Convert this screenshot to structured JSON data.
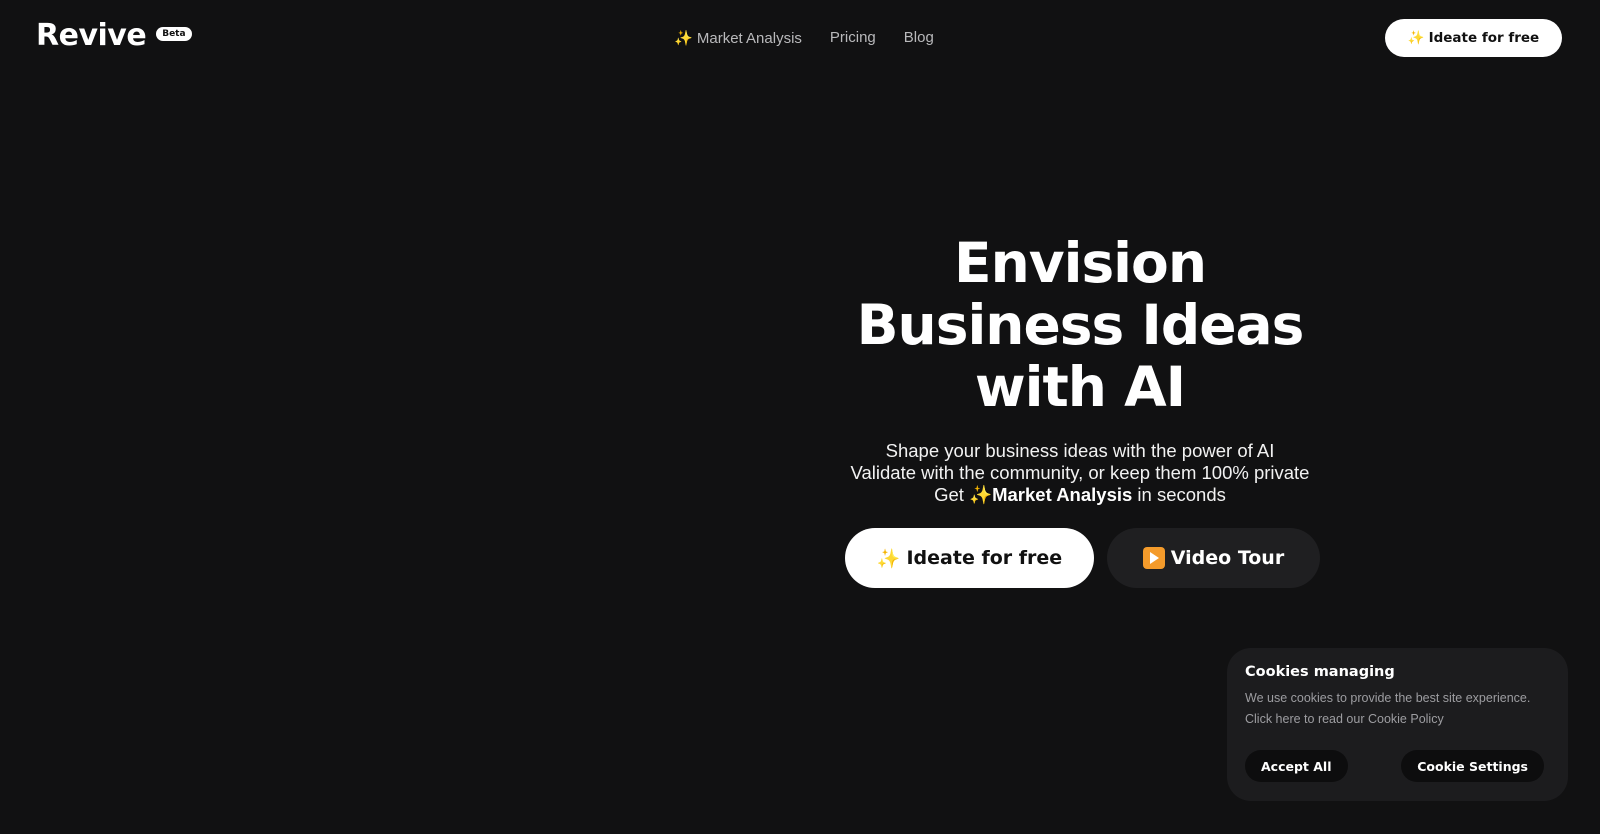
{
  "header": {
    "logo": "Revive",
    "badge": "Beta",
    "nav": [
      {
        "sparkle": "✨",
        "label": "Market Analysis"
      },
      {
        "label": "Pricing"
      },
      {
        "label": "Blog"
      }
    ],
    "cta": {
      "sparkle": "✨",
      "label": "Ideate for free"
    }
  },
  "hero": {
    "title_lines": [
      "Envision",
      "Business Ideas",
      "with AI"
    ],
    "subtitle_line1": "Shape your business ideas with the power of AI",
    "subtitle_line2": "Validate with the community, or keep them 100% private",
    "subtitle_line3_prefix": "Get ",
    "subtitle_line3_sparkle": "✨",
    "subtitle_line3_bold": "Market Analysis",
    "subtitle_line3_suffix": " in seconds",
    "primary_button": {
      "sparkle": "✨",
      "label": "Ideate for free"
    },
    "secondary_button": {
      "label": "Video Tour"
    }
  },
  "cookie_banner": {
    "title": "Cookies managing",
    "text_line1": "We use cookies to provide the best site experience.",
    "text_line2": "Click here to read our Cookie Policy",
    "accept_label": "Accept All",
    "settings_label": "Cookie Settings"
  },
  "colors": {
    "background": "#111112",
    "button_light": "#ffffff",
    "button_dark": "#1f1f21",
    "cookie_panel": "#1c1c1e"
  }
}
